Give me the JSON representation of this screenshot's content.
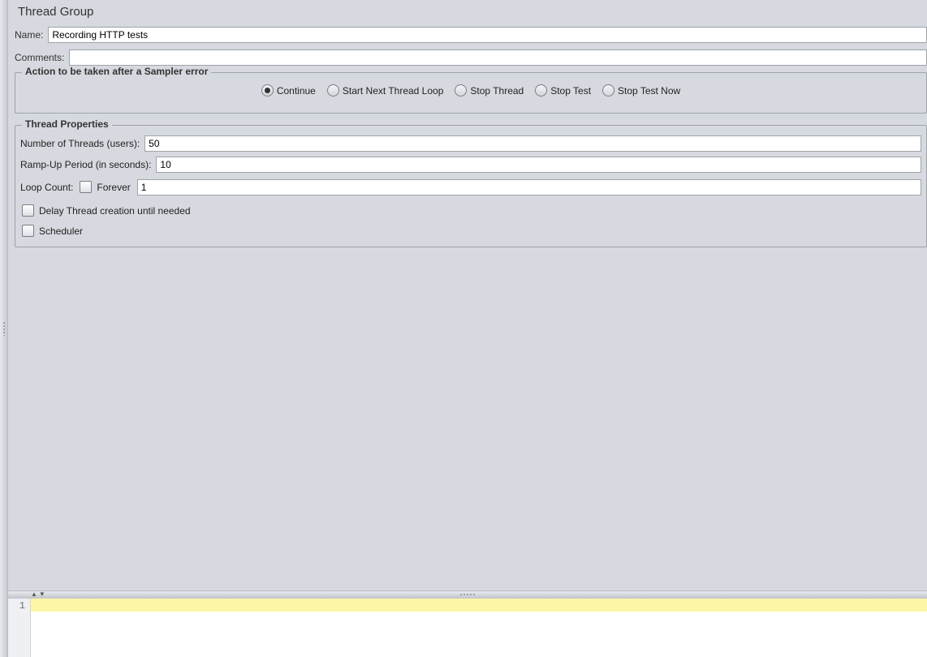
{
  "header": {
    "title": "Thread Group"
  },
  "fields": {
    "name_label": "Name:",
    "name_value": "Recording HTTP tests",
    "comments_label": "Comments:",
    "comments_value": ""
  },
  "samplerError": {
    "legend": "Action to be taken after a Sampler error",
    "options": [
      {
        "id": "continue",
        "label": "Continue",
        "checked": true
      },
      {
        "id": "next-loop",
        "label": "Start Next Thread Loop",
        "checked": false
      },
      {
        "id": "stop-thread",
        "label": "Stop Thread",
        "checked": false
      },
      {
        "id": "stop-test",
        "label": "Stop Test",
        "checked": false
      },
      {
        "id": "stop-test-now",
        "label": "Stop Test Now",
        "checked": false
      }
    ]
  },
  "threadProps": {
    "legend": "Thread Properties",
    "numThreads": {
      "label": "Number of Threads (users):",
      "value": "50"
    },
    "rampUp": {
      "label": "Ramp-Up Period (in seconds):",
      "value": "10"
    },
    "loop": {
      "label": "Loop Count:",
      "forever_label": "Forever",
      "forever_checked": false,
      "value": "1"
    },
    "delay": {
      "label": "Delay Thread creation until needed",
      "checked": false
    },
    "scheduler": {
      "label": "Scheduler",
      "checked": false
    }
  },
  "log": {
    "line_number": "1"
  }
}
